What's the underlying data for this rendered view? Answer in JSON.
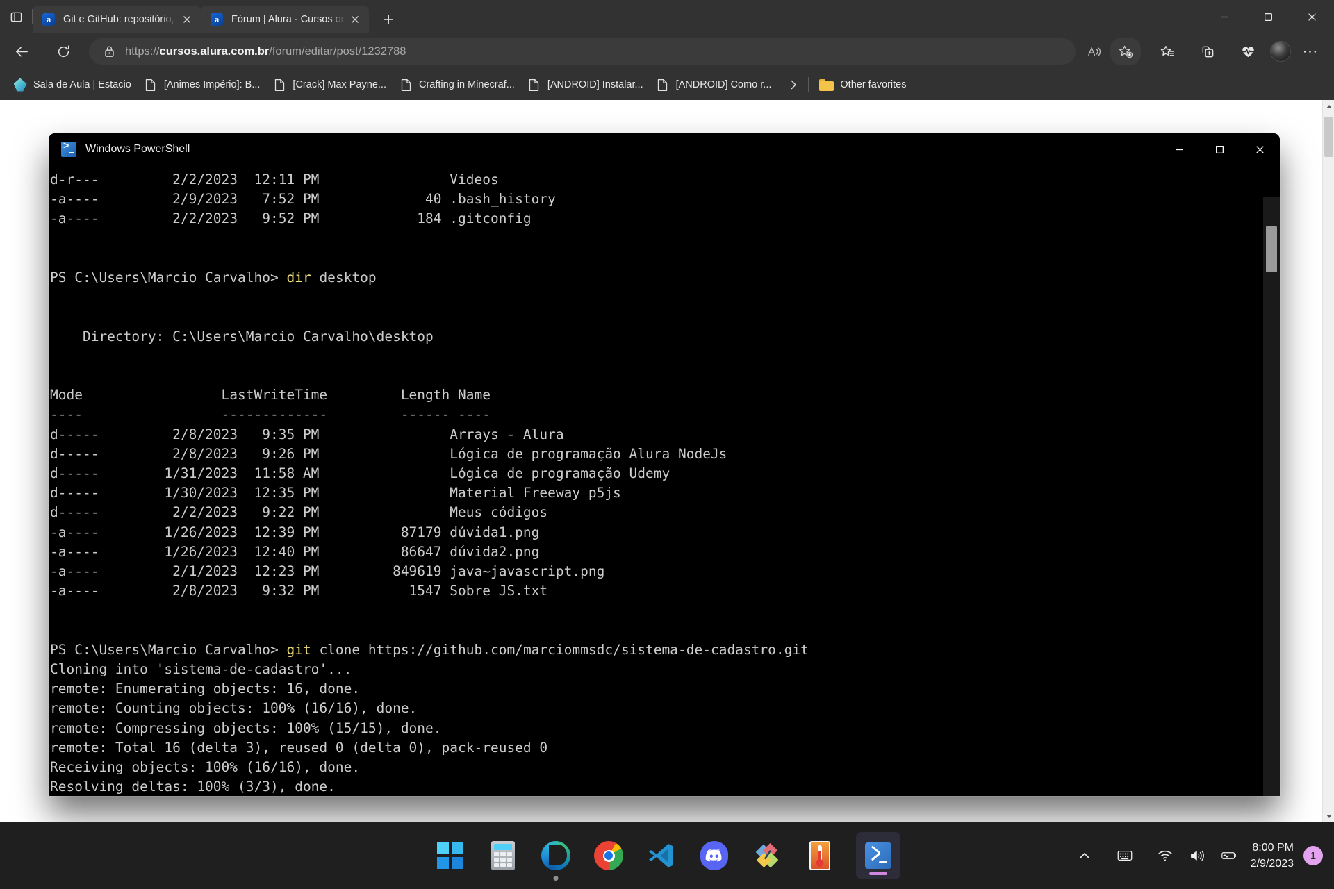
{
  "browser": {
    "tabs": [
      {
        "title": "Git e GitHub: repositório, commit",
        "favicon": "alura-favicon",
        "active": false
      },
      {
        "title": "Fórum | Alura - Cursos online de",
        "favicon": "alura-favicon",
        "active": true
      }
    ],
    "new_tab_label": "+",
    "tab_actions_icon": "tab-list-icon",
    "window_controls": {
      "minimize": "minimize-icon",
      "maximize": "maximize-icon",
      "close": "close-icon"
    },
    "nav": {
      "back_icon": "back-arrow-icon",
      "refresh_icon": "refresh-icon",
      "lock_icon": "lock-icon"
    },
    "address": {
      "scheme": "https://",
      "host": "cursos.alura.com.br",
      "path": "/forum/editar/post/1232788",
      "full": "https://cursos.alura.com.br/forum/editar/post/1232788"
    },
    "toolbar_icons": [
      "read-aloud-icon",
      "add-favorite-icon",
      "favorites-icon",
      "collections-icon",
      "browser-essentials-icon",
      "profile-avatar",
      "settings-and-more-icon"
    ],
    "favorites": [
      {
        "label": "Sala de Aula | Estacio",
        "icon": "estacio-diamond-icon"
      },
      {
        "label": "[Animes Império]: B...",
        "icon": "page-icon"
      },
      {
        "label": "[Crack] Max Payne...",
        "icon": "page-icon"
      },
      {
        "label": "Crafting in Minecraf...",
        "icon": "page-icon"
      },
      {
        "label": "[ANDROID] Instalar...",
        "icon": "page-icon"
      },
      {
        "label": "[ANDROID] Como r...",
        "icon": "page-icon"
      }
    ],
    "favorites_overflow_icon": "chevron-right-icon",
    "other_favorites": {
      "label": "Other favorites",
      "icon": "folder-icon"
    }
  },
  "powershell": {
    "title": "Windows PowerShell",
    "logo_icon": "powershell-icon",
    "controls": {
      "minimize": "minimize-icon",
      "maximize": "maximize-icon",
      "close": "close-icon"
    },
    "lines": [
      {
        "text": "d-r---         2/2/2023  12:11 PM                Videos"
      },
      {
        "text": "-a----         2/9/2023   7:52 PM             40 .bash_history"
      },
      {
        "text": "-a----         2/2/2023   9:52 PM            184 .gitconfig"
      },
      {
        "text": ""
      },
      {
        "text": ""
      },
      {
        "prompt": "PS C:\\Users\\Marcio Carvalho> ",
        "cmd": "dir",
        "rest": " desktop"
      },
      {
        "text": ""
      },
      {
        "text": ""
      },
      {
        "text": "    Directory: C:\\Users\\Marcio Carvalho\\desktop"
      },
      {
        "text": ""
      },
      {
        "text": ""
      },
      {
        "text": "Mode                 LastWriteTime         Length Name"
      },
      {
        "text": "----                 -------------         ------ ----"
      },
      {
        "text": "d-----         2/8/2023   9:35 PM                Arrays - Alura"
      },
      {
        "text": "d-----         2/8/2023   9:26 PM                Lógica de programação Alura NodeJs"
      },
      {
        "text": "d-----        1/31/2023  11:58 AM                Lógica de programação Udemy"
      },
      {
        "text": "d-----        1/30/2023  12:35 PM                Material Freeway p5js"
      },
      {
        "text": "d-----         2/2/2023   9:22 PM                Meus códigos"
      },
      {
        "text": "-a----        1/26/2023  12:39 PM          87179 dúvida1.png"
      },
      {
        "text": "-a----        1/26/2023  12:40 PM          86647 dúvida2.png"
      },
      {
        "text": "-a----         2/1/2023  12:23 PM         849619 java~javascript.png"
      },
      {
        "text": "-a----         2/8/2023   9:32 PM           1547 Sobre JS.txt"
      },
      {
        "text": ""
      },
      {
        "text": ""
      },
      {
        "prompt": "PS C:\\Users\\Marcio Carvalho> ",
        "cmd": "git",
        "rest": " clone https://github.com/marciommsdc/sistema-de-cadastro.git"
      },
      {
        "text": "Cloning into 'sistema-de-cadastro'..."
      },
      {
        "text": "remote: Enumerating objects: 16, done."
      },
      {
        "text": "remote: Counting objects: 100% (16/16), done."
      },
      {
        "text": "remote: Compressing objects: 100% (15/15), done."
      },
      {
        "text": "remote: Total 16 (delta 3), reused 0 (delta 0), pack-reused 0"
      },
      {
        "text": "Receiving objects: 100% (16/16), done."
      },
      {
        "text": "Resolving deltas: 100% (3/3), done."
      }
    ]
  },
  "taskbar": {
    "items": [
      {
        "name": "start-button",
        "icon": "windows-logo-icon",
        "running": false
      },
      {
        "name": "calculator",
        "icon": "calculator-icon",
        "running": false
      },
      {
        "name": "microsoft-edge",
        "icon": "edge-icon",
        "running": true
      },
      {
        "name": "google-chrome",
        "icon": "chrome-icon",
        "running": false
      },
      {
        "name": "visual-studio-code",
        "icon": "vscode-icon",
        "running": false
      },
      {
        "name": "discord",
        "icon": "discord-icon",
        "running": false
      },
      {
        "name": "paint-net",
        "icon": "paint-net-icon",
        "running": false
      },
      {
        "name": "core-temp",
        "icon": "thermometer-icon",
        "running": false
      },
      {
        "name": "windows-powershell",
        "icon": "powershell-icon",
        "running": true,
        "active": true
      }
    ],
    "tray": {
      "show_hidden_icons": "chevron-up-icon",
      "touch_keyboard": "keyboard-icon",
      "network": "wifi-icon",
      "volume": "speaker-icon",
      "battery": "battery-icon",
      "time": "8:00 PM",
      "date": "2/9/2023",
      "notification_count": "1"
    }
  },
  "colors": {
    "chrome_bg": "#323232",
    "tab_active": "#3b3b3b",
    "terminal_bg": "#000000",
    "terminal_fg": "#cccccc",
    "terminal_accent": "#f2e07a",
    "taskbar_bg": "#1f1f1f",
    "badge": "#e2a4ef"
  }
}
